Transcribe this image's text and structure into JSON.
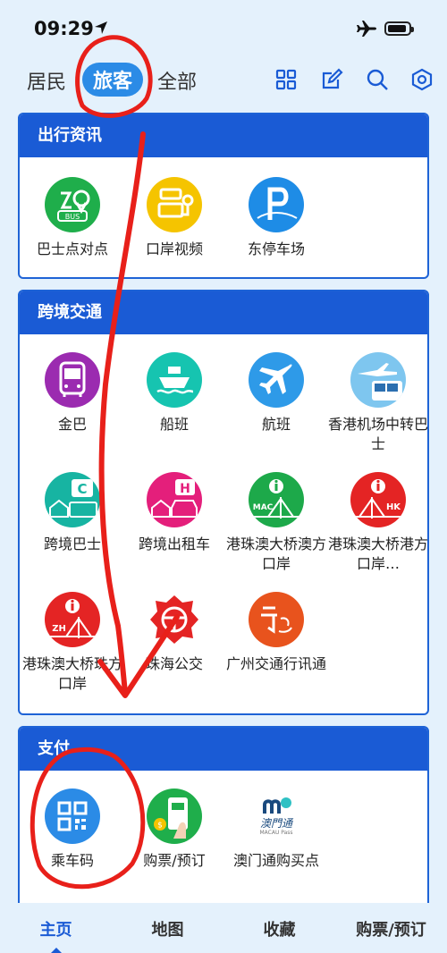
{
  "status": {
    "time": "09:29"
  },
  "modes": [
    {
      "label": "居民"
    },
    {
      "label": "旅客"
    },
    {
      "label": "全部"
    }
  ],
  "sections": [
    {
      "title": "出行资讯",
      "items": [
        {
          "label": "巴士点对点",
          "icon": "bus-stop-icon",
          "color": "#1fae4b"
        },
        {
          "label": "口岸视频",
          "icon": "port-camera-icon",
          "color": "#f5c400"
        },
        {
          "label": "东停车场",
          "icon": "parking-icon",
          "color": "#1e8ce6"
        }
      ]
    },
    {
      "title": "跨境交通",
      "items": [
        {
          "label": "金巴",
          "icon": "gold-bus-icon",
          "color": "#9b2bb0"
        },
        {
          "label": "船班",
          "icon": "ferry-icon",
          "color": "#16c4b0"
        },
        {
          "label": "航班",
          "icon": "airplane-icon",
          "color": "#2e9ae8"
        },
        {
          "label": "香港机场中转巴士",
          "icon": "airport-bus-icon",
          "color": "#7ec6ef"
        },
        {
          "label": "跨境巴士",
          "icon": "crossborder-bus-icon",
          "color": "#17b4a2"
        },
        {
          "label": "跨境出租车",
          "icon": "taxi-icon",
          "color": "#e41f7b"
        },
        {
          "label": "港珠澳大桥澳方口岸",
          "icon": "bridge-macau-icon",
          "color": "#1da94a"
        },
        {
          "label": "港珠澳大桥港方口岸…",
          "icon": "bridge-hk-icon",
          "color": "#e42424"
        },
        {
          "label": "港珠澳大桥珠方口岸",
          "icon": "bridge-zhuhai-icon",
          "color": "#e42424"
        },
        {
          "label": "珠海公交",
          "icon": "zhuhai-bus-icon",
          "color": "#e42424"
        },
        {
          "label": "广州交通行讯通",
          "icon": "guangzhou-traffic-icon",
          "color": "#e8531d"
        }
      ]
    },
    {
      "title": "支付",
      "items": [
        {
          "label": "乘车码",
          "icon": "qr-code-icon",
          "color": "#2b8be6"
        },
        {
          "label": "购票/预订",
          "icon": "ticket-icon",
          "color": "#1fae4b"
        },
        {
          "label": "澳门通购买点",
          "icon": "macau-pass-icon",
          "color": "#ffffff"
        }
      ]
    }
  ],
  "macau_pass_logo": {
    "line1": "澳門通",
    "line2": "MACAU Pass"
  },
  "tabs": [
    {
      "label": "主页"
    },
    {
      "label": "地图"
    },
    {
      "label": "收藏"
    },
    {
      "label": "购票/预订"
    }
  ],
  "colors": {
    "accent": "#1a5bd5",
    "annotation": "#e8201a"
  }
}
